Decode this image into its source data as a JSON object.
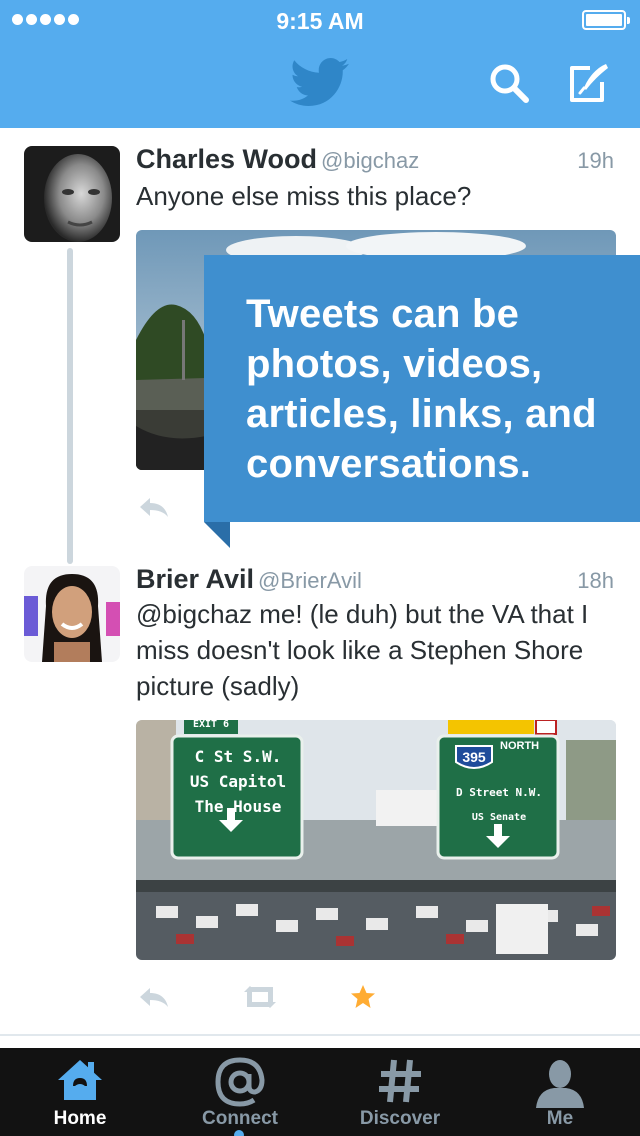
{
  "status_bar": {
    "time": "9:15 AM"
  },
  "header": {
    "logo": "twitter-bird-icon",
    "actions": [
      "search-icon",
      "compose-icon"
    ]
  },
  "tweets": [
    {
      "name": "Charles Wood",
      "handle": "@bigchaz",
      "time": "19h",
      "text": "Anyone else miss this place?",
      "media": "road-landscape-photo"
    },
    {
      "name": "Brier Avil",
      "handle": "@BrierAvil",
      "time": "18h",
      "text": "@bigchaz me! (le duh) but the VA that I miss doesn't look like a Stephen Shore picture (sadly)",
      "media": {
        "sign_left": {
          "exit": "EXIT 6",
          "lines": [
            "C St S.W.",
            "US Capitol",
            "The House"
          ]
        },
        "sign_right": {
          "shield": "395",
          "direction": "NORTH",
          "line1": "D Street N.W.",
          "line2": "US Senate"
        }
      }
    }
  ],
  "callout": {
    "text": "Tweets can be photos, videos, articles, links, and conversations."
  },
  "tabbar": {
    "tabs": [
      {
        "label": "Home",
        "icon": "home-icon",
        "active": true
      },
      {
        "label": "Connect",
        "icon": "at-icon",
        "active": false
      },
      {
        "label": "Discover",
        "icon": "hashtag-icon",
        "active": false
      },
      {
        "label": "Me",
        "icon": "person-icon",
        "active": false
      }
    ]
  },
  "colors": {
    "header": "#55acee",
    "callout": "#3f8fcf",
    "tabbar": "#121212",
    "favorite": "#ffac33"
  }
}
